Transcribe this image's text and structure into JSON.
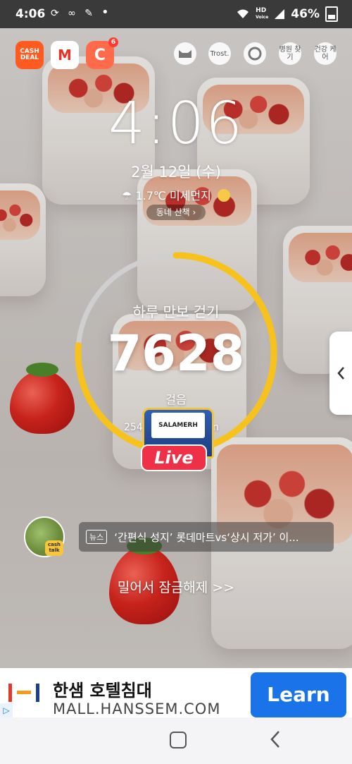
{
  "status_bar": {
    "time": "4:06",
    "left_icons": "⟳ ∞ ✎",
    "dot": "•",
    "network": "HD",
    "network_sub": "Voice",
    "battery": "46%"
  },
  "apps": {
    "cashdeal": "CASH DEAL",
    "m_app": "M",
    "c_app": "C",
    "c_badge": "6",
    "trost": "Trost.",
    "hospital": "병원 찾기",
    "health": "건강 케어"
  },
  "lock": {
    "clock": "4:06",
    "date": "2월 12일 (수)",
    "weather": "1.7℃ 미세먼지",
    "neighborhood": "동네 산책"
  },
  "steps": {
    "title": "하루 만보 걷기",
    "count": "7628",
    "subtitle": "걸음",
    "note_left": "254",
    "note_right": "n",
    "progress": 0.7628
  },
  "live": {
    "brand": "SALAMERH",
    "label": "Live"
  },
  "news": {
    "avatar_tag": "cash talk",
    "tag": "뉴스",
    "text": "‘간편식 성지’ 롯데마트vs‘상시 저가’ 이..."
  },
  "unlock": {
    "text": "밀어서 잠금해제 >>"
  },
  "ad": {
    "title": "한샘 호텔침대",
    "url": "MALL.HANSSEM.COM",
    "button": "Learn"
  },
  "colors": {
    "ring_progress": "#f7c21c",
    "ring_track": "#cfcfcf",
    "ad_button": "#1a73e8"
  }
}
